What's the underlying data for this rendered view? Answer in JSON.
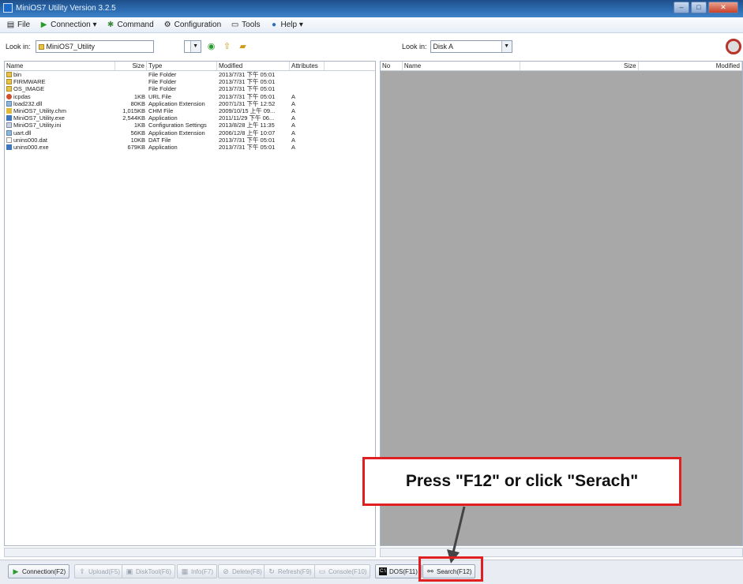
{
  "window": {
    "title": "MiniOS7 Utility Version 3.2.5",
    "controls": [
      "–",
      "□",
      "✕"
    ]
  },
  "menu": [
    {
      "label": "File",
      "icon": "file-icon"
    },
    {
      "label": "Connection ▾",
      "icon": "connection-icon"
    },
    {
      "label": "Command",
      "icon": "command-icon"
    },
    {
      "label": "Configuration",
      "icon": "configuration-icon"
    },
    {
      "label": "Tools",
      "icon": "tools-icon"
    },
    {
      "label": "Help ▾",
      "icon": "help-icon"
    }
  ],
  "left": {
    "lookin_label": "Look in:",
    "lookin_value": "MiniOS7_Utility",
    "columns": [
      "Name",
      "Size",
      "Type",
      "Modified",
      "Attributes"
    ],
    "files": [
      {
        "name": "bin",
        "size": "",
        "type": "File Folder",
        "modified": "2013/7/31 下午 05:01",
        "attr": "",
        "icon": "folder"
      },
      {
        "name": "FIRMWARE",
        "size": "",
        "type": "File Folder",
        "modified": "2013/7/31 下午 05:01",
        "attr": "",
        "icon": "folder"
      },
      {
        "name": "OS_IMAGE",
        "size": "",
        "type": "File Folder",
        "modified": "2013/7/31 下午 05:01",
        "attr": "",
        "icon": "folder"
      },
      {
        "name": "icpdas",
        "size": "1KB",
        "type": "URL File",
        "modified": "2013/7/31 下午 05:01",
        "attr": "A",
        "icon": "url"
      },
      {
        "name": "load232.dll",
        "size": "80KB",
        "type": "Application Extension",
        "modified": "2007/1/31 下午 12:52",
        "attr": "A",
        "icon": "dll"
      },
      {
        "name": "MiniOS7_Utility.chm",
        "size": "1,015KB",
        "type": "CHM File",
        "modified": "2009/10/15 上午 09...",
        "attr": "A",
        "icon": "chm"
      },
      {
        "name": "MiniOS7_Utility.exe",
        "size": "2,544KB",
        "type": "Application",
        "modified": "2011/11/29 下午 06...",
        "attr": "A",
        "icon": "exe"
      },
      {
        "name": "MiniOS7_Utility.ini",
        "size": "1KB",
        "type": "Configuration Settings",
        "modified": "2013/8/28 上午 11:35",
        "attr": "A",
        "icon": "ini"
      },
      {
        "name": "uart.dll",
        "size": "56KB",
        "type": "Application Extension",
        "modified": "2006/12/8 上午 10:07",
        "attr": "A",
        "icon": "dll"
      },
      {
        "name": "unins000.dat",
        "size": "10KB",
        "type": "DAT File",
        "modified": "2013/7/31 下午 05:01",
        "attr": "A",
        "icon": "dat"
      },
      {
        "name": "unins000.exe",
        "size": "679KB",
        "type": "Application",
        "modified": "2013/7/31 下午 05:01",
        "attr": "A",
        "icon": "exe"
      }
    ]
  },
  "right": {
    "lookin_label": "Look in:",
    "lookin_value": "Disk A",
    "columns": [
      "No",
      "Name",
      "Size",
      "Modified"
    ]
  },
  "buttons": [
    {
      "label": "Connection(F2)",
      "enabled": true,
      "icon": "connection-icon"
    },
    {
      "label": "Upload(F5)",
      "enabled": false,
      "icon": "upload-icon"
    },
    {
      "label": "DiskTool(F6)",
      "enabled": false,
      "icon": "disktool-icon"
    },
    {
      "label": "Info(F7)",
      "enabled": false,
      "icon": "info-icon"
    },
    {
      "label": "Delete(F8)",
      "enabled": false,
      "icon": "delete-icon"
    },
    {
      "label": "Refresh(F9)",
      "enabled": false,
      "icon": "refresh-icon"
    },
    {
      "label": "Console(F10)",
      "enabled": false,
      "icon": "console-icon"
    },
    {
      "label": "DOS(F11)",
      "enabled": true,
      "icon": "dos-icon"
    },
    {
      "label": "Search(F12)",
      "enabled": true,
      "icon": "binoculars-icon"
    }
  ],
  "annotation": {
    "text": "Press \"F12\" or click \"Serach\"",
    "color": "#e02020"
  }
}
